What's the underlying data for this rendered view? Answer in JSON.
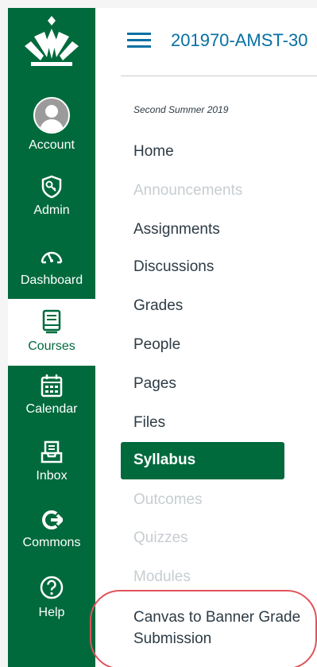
{
  "global_nav": {
    "logo_icon": "university-crest-icon",
    "items": [
      {
        "label": "Account",
        "icon": "user-avatar-icon"
      },
      {
        "label": "Admin",
        "icon": "shield-key-icon"
      },
      {
        "label": "Dashboard",
        "icon": "speedometer-icon"
      },
      {
        "label": "Courses",
        "icon": "book-icon",
        "active": true
      },
      {
        "label": "Calendar",
        "icon": "calendar-icon"
      },
      {
        "label": "Inbox",
        "icon": "inbox-icon"
      },
      {
        "label": "Commons",
        "icon": "commons-arrow-icon"
      },
      {
        "label": "Help",
        "icon": "help-circle-icon"
      }
    ]
  },
  "header": {
    "menu_icon": "hamburger-icon",
    "breadcrumb": "201970-AMST-30"
  },
  "course_nav": {
    "term": "Second Summer 2019",
    "items": [
      {
        "label": "Home"
      },
      {
        "label": "Announcements"
      },
      {
        "label": "Assignments"
      },
      {
        "label": "Discussions"
      },
      {
        "label": "Grades"
      },
      {
        "label": "People"
      },
      {
        "label": "Pages"
      },
      {
        "label": "Files"
      },
      {
        "label": "Syllabus"
      },
      {
        "label": "Outcomes"
      },
      {
        "label": "Quizzes"
      },
      {
        "label": "Modules"
      },
      {
        "label": "Canvas to Banner Grade Submission"
      }
    ]
  },
  "colors": {
    "brand_green": "#006a3c",
    "link_blue": "#0770a3",
    "text_dark": "#2d3b45",
    "disabled_gray": "#c7cdd1",
    "highlight_red": "#e0535a"
  }
}
